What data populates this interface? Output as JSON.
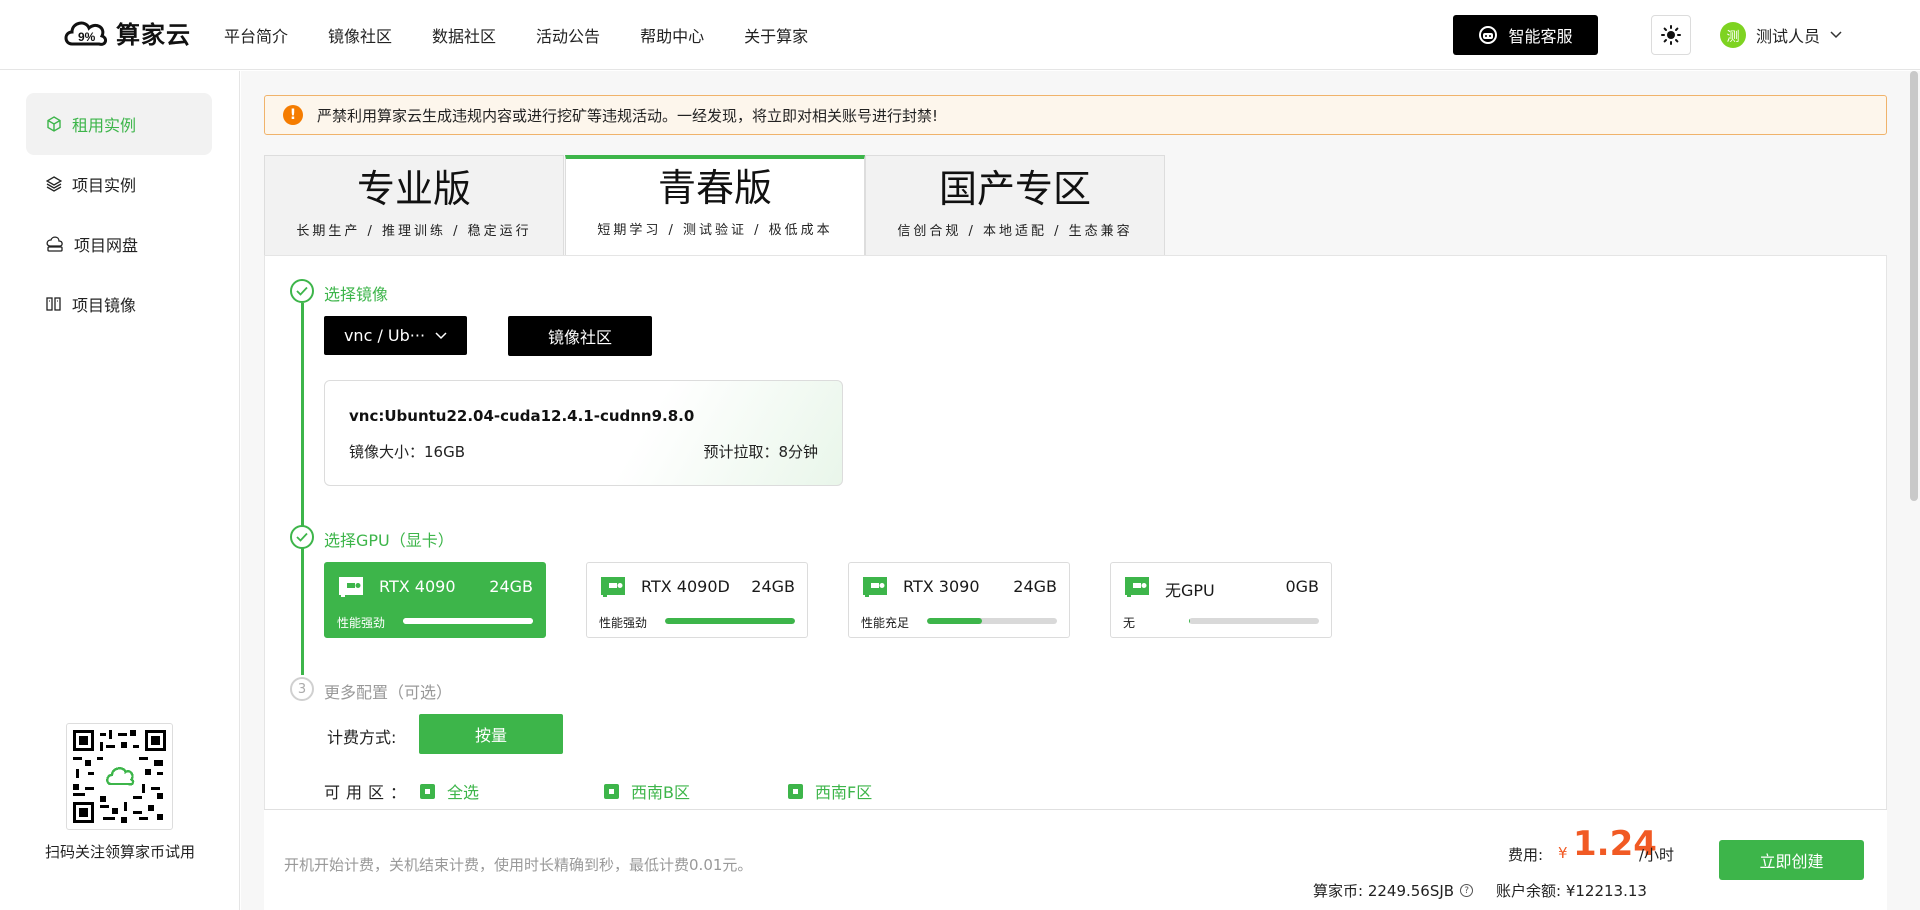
{
  "brand": {
    "name": "算家云"
  },
  "nav": [
    {
      "label": "平台简介"
    },
    {
      "label": "镜像社区"
    },
    {
      "label": "数据社区"
    },
    {
      "label": "活动公告"
    },
    {
      "label": "帮助中心"
    },
    {
      "label": "关于算家"
    }
  ],
  "header": {
    "service_label": "智能客服",
    "user_avatar_text": "测",
    "user_name": "测试人员"
  },
  "sidebar": {
    "items": [
      {
        "label": "租用实例",
        "icon": "cube-icon",
        "active": true
      },
      {
        "label": "项目实例",
        "icon": "layers-icon",
        "active": false
      },
      {
        "label": "项目网盘",
        "icon": "cloud-disk-icon",
        "active": false
      },
      {
        "label": "项目镜像",
        "icon": "image-stack-icon",
        "active": false
      }
    ],
    "qr_caption": "扫码关注领算家币试用"
  },
  "warning": {
    "icon_text": "!",
    "text": "严禁利用算家云生成违规内容或进行挖矿等违规活动。一经发现，将立即对相关账号进行封禁!"
  },
  "tabs": [
    {
      "title": "专业版",
      "subtitle": "长期生产 / 推理训练 / 稳定运行",
      "active": false
    },
    {
      "title": "青春版",
      "subtitle": "短期学习 / 测试验证 / 极低成本",
      "active": true
    },
    {
      "title": "国产专区",
      "subtitle": "信创合规 / 本地适配 / 生态兼容",
      "active": false
    }
  ],
  "steps": {
    "image": {
      "label": "选择镜像"
    },
    "gpu": {
      "label": "选择GPU（显卡）"
    },
    "more": {
      "number": "3",
      "label": "更多配置（可选）"
    }
  },
  "image": {
    "selected_short": "vnc / Ub···",
    "community_button": "镜像社区",
    "name": "vnc:Ubuntu22.04-cuda12.4.1-cudnn9.8.0",
    "size": "镜像大小：16GB",
    "pull": "预计拉取：8分钟"
  },
  "gpus": [
    {
      "name": "RTX 4090",
      "mem": "24GB",
      "perf": "性能强劲",
      "level": 1.0,
      "active": true
    },
    {
      "name": "RTX 4090D",
      "mem": "24GB",
      "perf": "性能强劲",
      "level": 1.0,
      "active": false
    },
    {
      "name": "RTX 3090",
      "mem": "24GB",
      "perf": "性能充足",
      "level": 0.42,
      "active": false
    },
    {
      "name": "无GPU",
      "mem": "0GB",
      "perf": "无",
      "level": 0.01,
      "active": false
    }
  ],
  "config": {
    "billing_label": "计费方式:",
    "billing_option": "按量",
    "zone_label": "可用区：",
    "zones": [
      "全选",
      "西南B区",
      "西南F区"
    ]
  },
  "footer": {
    "note": "开机开始计费，关机结束计费，使用时长精确到秒，最低计费0.01元。",
    "fee_label": "费用:",
    "currency": "¥",
    "price": "1.24",
    "unit": "/小时",
    "coins": "算家币:  2249.56SJB",
    "help": "?",
    "balance": "账户余额:  ¥12213.13",
    "create_button": "立即创建"
  },
  "colors": {
    "accent": "#3db54a",
    "price": "#f15a24",
    "warning_bg": "#fdf6ec",
    "warning_icon": "#f57c00"
  }
}
